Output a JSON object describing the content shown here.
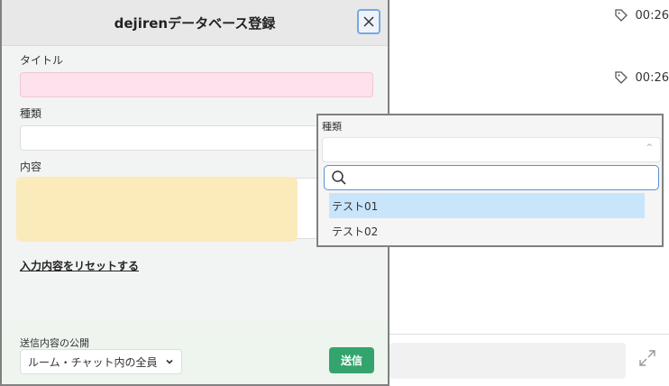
{
  "background": {
    "rows": [
      {
        "icon": "tag-icon",
        "time": "00:26"
      },
      {
        "icon": "tag-icon",
        "time": "00:26"
      }
    ]
  },
  "modal": {
    "title": "dejirenデータベース登録",
    "fields": {
      "title_label": "タイトル",
      "kind_label": "種類",
      "content_label": "内容"
    },
    "reset_link": "入力内容をリセットする",
    "publish_label": "送信内容の公開",
    "publish_value": "ルーム・チャット内の全員",
    "send_label": "送信"
  },
  "popup": {
    "label": "種類",
    "options": [
      "テスト01",
      "テスト02"
    ],
    "selected_index": 0
  },
  "colors": {
    "send_button": "#34a46e",
    "title_field_bg": "#fde1ec",
    "content_highlight": "#fbe9b6",
    "option_highlight": "#c9e5fb",
    "focus_border": "#5b8fd6"
  }
}
